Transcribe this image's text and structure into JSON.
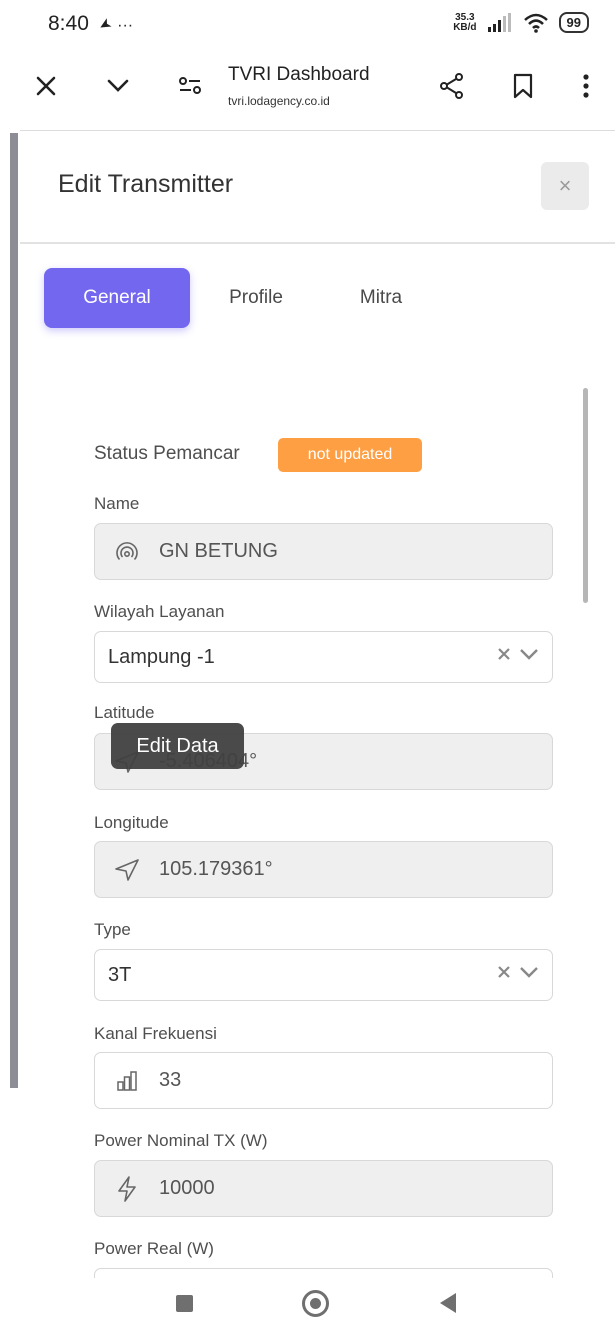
{
  "status_bar": {
    "time": "8:40",
    "nav_arrow": "◀",
    "dots": "···",
    "speed_top": "35.3",
    "speed_bottom": "KB/d",
    "battery": "99"
  },
  "browser": {
    "title": "TVRI Dashboard",
    "url": "tvri.lodagency.co.id"
  },
  "modal": {
    "title": "Edit Transmitter",
    "close": "×"
  },
  "tabs": [
    {
      "label": "General",
      "active": true
    },
    {
      "label": "Profile",
      "active": false
    },
    {
      "label": "Mitra",
      "active": false
    }
  ],
  "form": {
    "status_label": "Status Pemancar",
    "status_badge": "not updated",
    "name_label": "Name",
    "name_value": "GN BETUNG",
    "wilayah_label": "Wilayah Layanan",
    "wilayah_value": "Lampung -1",
    "latitude_label": "Latitude",
    "latitude_value": "-5.406404°",
    "longitude_label": "Longitude",
    "longitude_value": "105.179361°",
    "type_label": "Type",
    "type_value": "3T",
    "kanal_label": "Kanal Frekuensi",
    "kanal_value": "33",
    "power_nominal_label": "Power Nominal TX (W)",
    "power_nominal_value": "10000",
    "power_real_label": "Power Real (W)"
  },
  "tooltip": "Edit Data",
  "colors": {
    "accent": "#7367f0",
    "badge": "#ff9f43"
  }
}
